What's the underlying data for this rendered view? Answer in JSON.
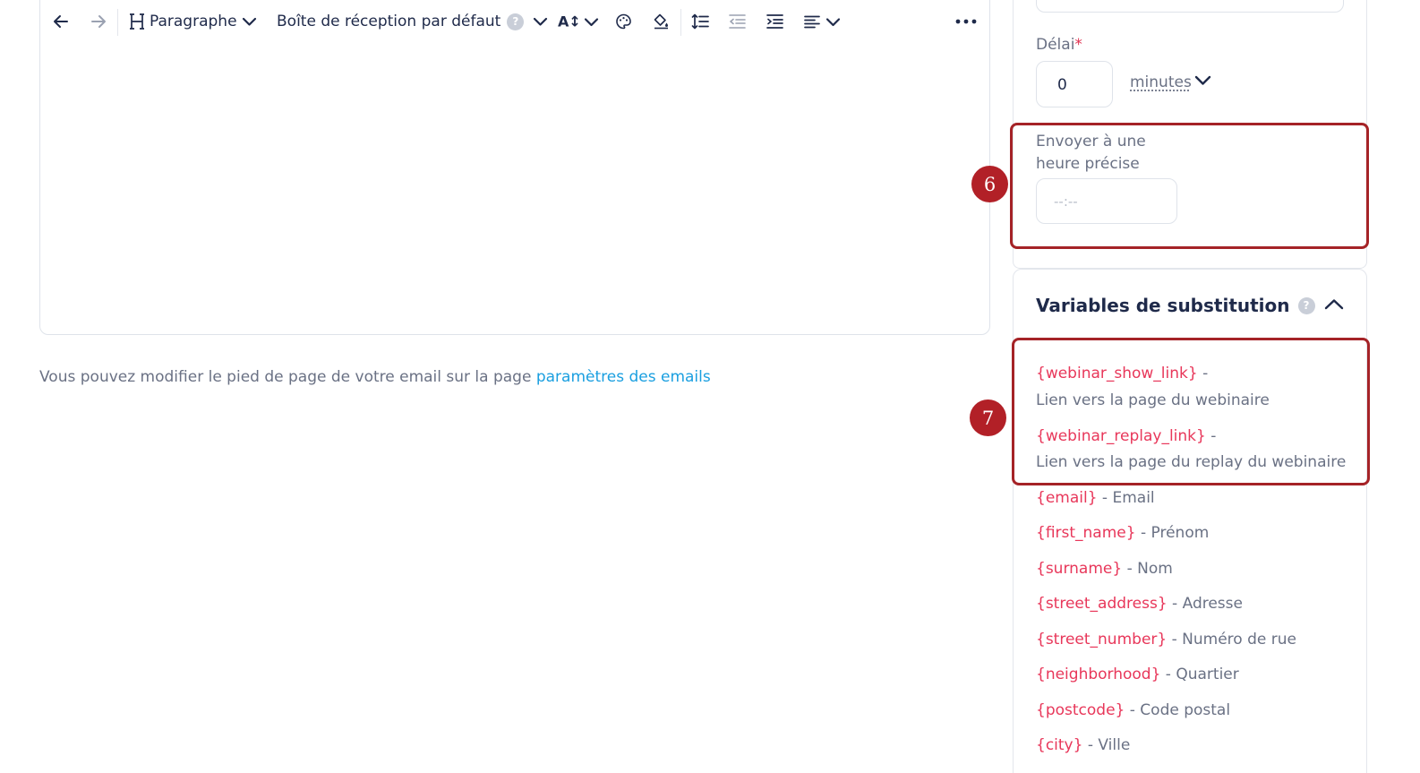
{
  "toolbar": {
    "heading_label": "Paragraphe",
    "inbox_label": "Boîte de réception par défaut",
    "help_glyph": "?",
    "font_size_glyph": "A↕"
  },
  "footer": {
    "text": "Vous pouvez modifier le pied de page de votre email sur la page ",
    "link": "paramètres des emails"
  },
  "settings": {
    "delay_label": "Délai",
    "delay_required": "*",
    "delay_value": "0",
    "delay_unit": "minutes",
    "send_at_label_line1": "Envoyer à une",
    "send_at_label_line2": "heure précise",
    "time_placeholder": "--:--"
  },
  "annotations": {
    "badge_6": "6",
    "badge_7": "7",
    "highlight_color": "#a52327"
  },
  "variables": {
    "title": "Variables de substitution",
    "help_glyph": "?",
    "items": [
      {
        "code": "{webinar_show_link}",
        "sep": " -",
        "desc": "Lien vers la page du webinaire"
      },
      {
        "code": "{webinar_replay_link}",
        "sep": " -",
        "desc": "Lien vers la page du replay du webinaire"
      },
      {
        "code": "{email}",
        "sep": " - ",
        "desc": "Email"
      },
      {
        "code": "{first_name}",
        "sep": " - ",
        "desc": "Prénom"
      },
      {
        "code": "{surname}",
        "sep": " - ",
        "desc": "Nom"
      },
      {
        "code": "{street_address}",
        "sep": " - ",
        "desc": "Adresse"
      },
      {
        "code": "{street_number}",
        "sep": " - ",
        "desc": "Numéro de rue"
      },
      {
        "code": "{neighborhood}",
        "sep": " - ",
        "desc": "Quartier"
      },
      {
        "code": "{postcode}",
        "sep": " - ",
        "desc": "Code postal"
      },
      {
        "code": "{city}",
        "sep": " - ",
        "desc": "Ville"
      }
    ]
  },
  "colors": {
    "text_dark": "#1f2a4a",
    "text_muted": "#6a7184",
    "variable_pink": "#e8375a",
    "link_blue": "#1a9fe0",
    "badge_red": "#b22027"
  }
}
